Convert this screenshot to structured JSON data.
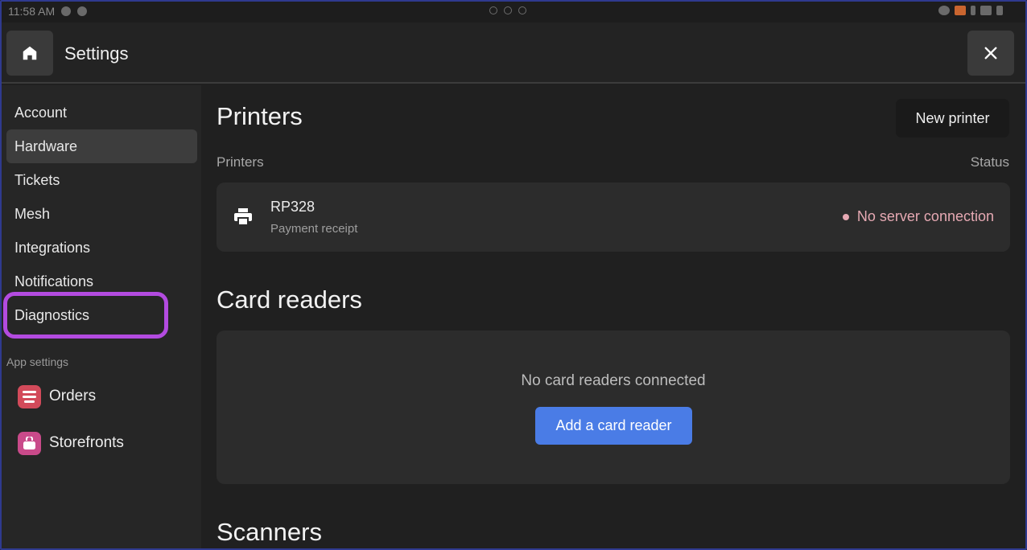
{
  "status_bar": {
    "time": "11:58 AM"
  },
  "header": {
    "title": "Settings",
    "home_icon": "home-icon",
    "close_icon": "close-icon"
  },
  "sidebar": {
    "items": [
      {
        "label": "Account",
        "active": false
      },
      {
        "label": "Hardware",
        "active": true
      },
      {
        "label": "Tickets",
        "active": false
      },
      {
        "label": "Mesh",
        "active": false
      },
      {
        "label": "Integrations",
        "active": false
      },
      {
        "label": "Notifications",
        "active": false
      },
      {
        "label": "Diagnostics",
        "active": false,
        "highlighted": true
      }
    ],
    "section_label": "App settings",
    "apps": [
      {
        "label": "Orders",
        "icon": "orders-icon",
        "color": "#d24a5a"
      },
      {
        "label": "Storefronts",
        "icon": "storefront-icon",
        "color": "#c94a8a"
      }
    ],
    "highlight_color": "#b34be0"
  },
  "printers": {
    "heading": "Printers",
    "new_button": "New printer",
    "col_name": "Printers",
    "col_status": "Status",
    "rows": [
      {
        "name": "RP328",
        "subtitle": "Payment receipt",
        "status": "No server connection",
        "status_color": "#e6a9b3",
        "icon": "printer-icon"
      }
    ]
  },
  "card_readers": {
    "heading": "Card readers",
    "empty_text": "No card readers connected",
    "add_button": "Add a card reader",
    "button_color": "#4a7ce6"
  },
  "scanners": {
    "heading": "Scanners"
  }
}
